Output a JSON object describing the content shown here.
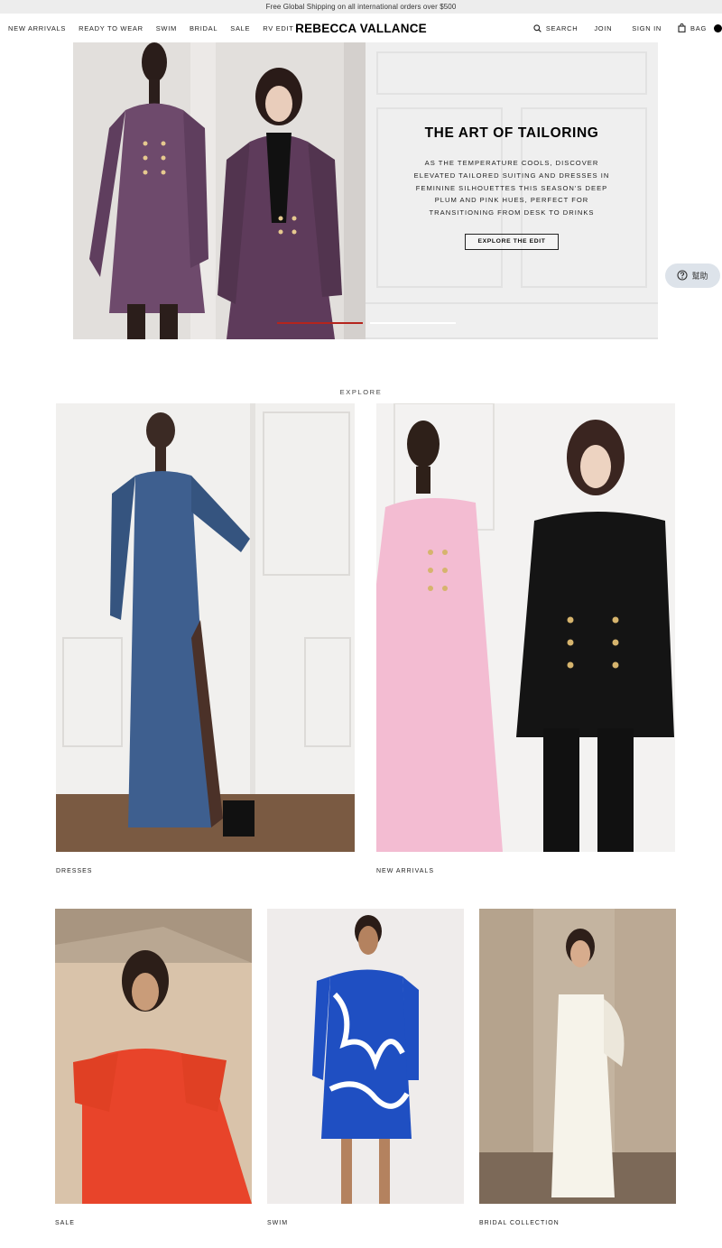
{
  "announcement": "Free Global Shipping on all international orders over $500",
  "nav": {
    "left": [
      "NEW ARRIVALS",
      "READY TO WEAR",
      "SWIM",
      "BRIDAL",
      "SALE",
      "RV EDIT"
    ],
    "logo": "REBECCA VALLANCE",
    "search": "SEARCH",
    "join": "JOIN",
    "sign_in": "SIGN IN",
    "bag": "BAG"
  },
  "hero": {
    "title": "THE ART OF TAILORING",
    "body": "AS THE TEMPERATURE COOLS, DISCOVER ELEVATED TAILORED SUITING AND DRESSES IN FEMININE SILHOUETTES THIS SEASON'S DEEP PLUM AND PINK HUES, PERFECT FOR TRANSITIONING FROM DESK TO DRINKS",
    "button": "EXPLORE THE EDIT",
    "slides": 2,
    "active_slide": 1
  },
  "help": {
    "label": "幫助",
    "icon": "question-icon"
  },
  "explore": {
    "label": "EXPLORE",
    "tiles": [
      {
        "label": "DRESSES"
      },
      {
        "label": "NEW ARRIVALS"
      },
      {
        "label": "SALE"
      },
      {
        "label": "SWIM"
      },
      {
        "label": "BRIDAL COLLECTION"
      }
    ]
  },
  "icons": {
    "search": "search-icon",
    "bag": "bag-icon"
  },
  "colors": {
    "accent": "#b5241d",
    "announcement_bg": "#ededed",
    "help_bg": "#dde3ea"
  }
}
